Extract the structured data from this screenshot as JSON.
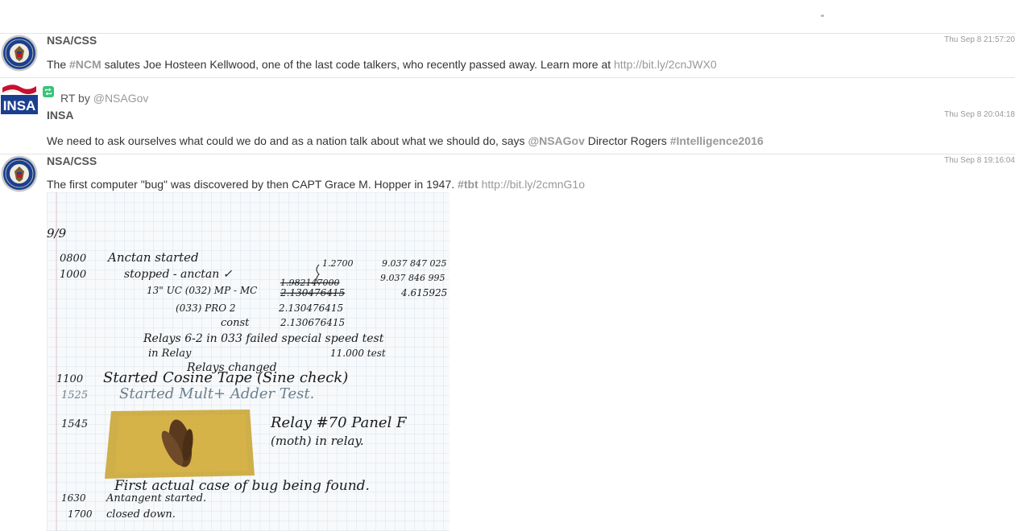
{
  "topbar": {
    "mark": "\""
  },
  "tweets": [
    {
      "author": "NSA/CSS",
      "time": "Thu Sep 8 21:57:20",
      "text_prefix": "The ",
      "hashtag": "#NCM",
      "text_mid": " salutes Joe Hosteen Kellwood, one of the last code talkers, who recently passed away. Learn more at ",
      "link": "http://bit.ly/2cnJWX0"
    },
    {
      "rt_label": "RT by ",
      "rt_handle": "@NSAGov",
      "author": "INSA",
      "avatar_text": "INSA",
      "time": "Thu Sep 8 20:04:18",
      "text_prefix": "We need to ask ourselves what could we do and as a nation talk about what we should do, says ",
      "mention": "@NSAGov",
      "text_mid": " Director Rogers ",
      "hashtag": "#Intelligence2016"
    },
    {
      "author": "NSA/CSS",
      "time": "Thu Sep 8 19:16:04",
      "text_prefix": "The first computer \"bug\" was discovered by then CAPT Grace M. Hopper in 1947. ",
      "hashtag": "#tbt",
      "link": "http://bit.ly/2cmnG1o",
      "photo_notes": {
        "n1": "9/9",
        "n2": "0800",
        "n3": "Anctan started",
        "n4": "1000",
        "n5": "stopped - anctan ✓",
        "n6": "13\" UC (032) MP - MC",
        "n7": "(033) PRO 2",
        "n8": "2.130476415",
        "n9": "const",
        "n10": "2.130676415",
        "n11": "Relays 6-2 in 033 failed special speed test",
        "n12": "in Relay",
        "n13": "11.000 test",
        "n14": "Relays changed",
        "n15": "1100",
        "n16": "Started Cosine Tape (Sine check)",
        "n17": "1525",
        "n18": "Started Mult+ Adder Test.",
        "n19": "1545",
        "n20": "Relay #70 Panel F",
        "n21": "(moth) in relay.",
        "n22": "First actual case of bug being found.",
        "n23": "1630",
        "n24": "Antangent started.",
        "n25": "1700",
        "n26": "closed down.",
        "n27": "1.2700",
        "n28": "9.037 847 025",
        "n29": "1.982147000",
        "n30": "9.037 846 995",
        "n31": "4.615925",
        "n32": "2.130476415"
      }
    }
  ],
  "colors": {
    "nsa_blue": "#1b3f8f",
    "insa_red": "#c8102e",
    "rt_green": "#3cc27a"
  }
}
